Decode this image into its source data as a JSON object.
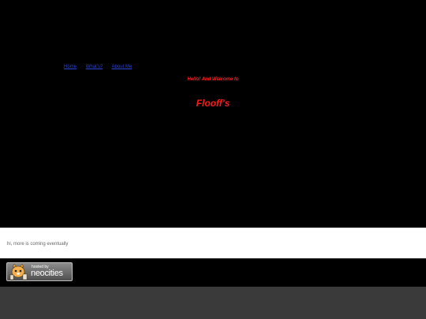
{
  "nav": {
    "links": [
      "Home",
      "What's?",
      "About Me"
    ]
  },
  "hero": {
    "greeting": "Hello! And Welcome to",
    "site_title": "Flooff's"
  },
  "content": {
    "text": "hi, more is coming eventually"
  },
  "footer": {
    "badge_small": "hosted by",
    "badge_big": "neocities"
  },
  "colors": {
    "hero_background": "#000000",
    "title_red": "#ff1818",
    "link_blue": "#2a44d6",
    "content_background": "#ffffff",
    "page_background": "#3a3a3a"
  }
}
